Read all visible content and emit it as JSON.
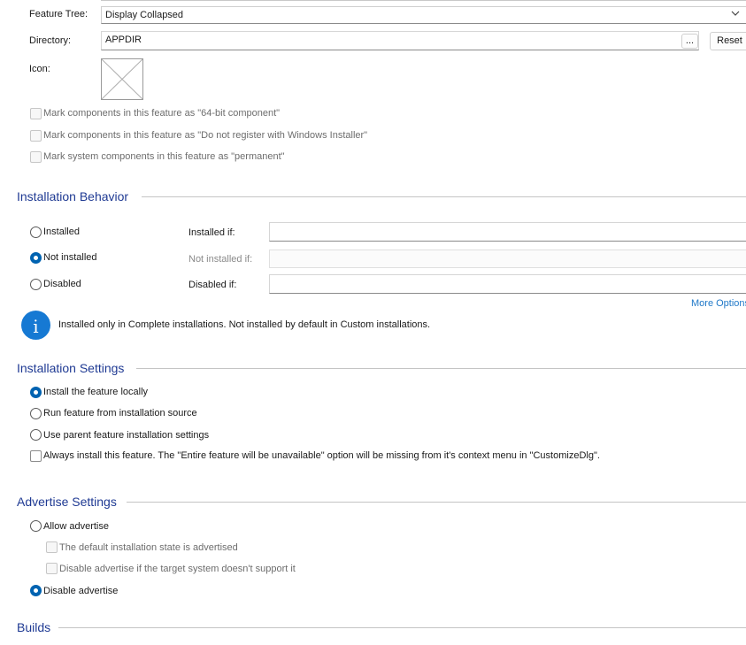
{
  "general": {
    "feature_tree_label": "Feature Tree:",
    "feature_tree_value": "Display Collapsed",
    "directory_label": "Directory:",
    "directory_value": "APPDIR",
    "browse_label": "...",
    "reset_label": "Reset",
    "icon_label": "Icon:",
    "options": [
      {
        "label": "Mark components in this feature as \"64-bit component\"",
        "checked": false,
        "enabled": false
      },
      {
        "label": "Mark components in this feature as \"Do not register with Windows Installer\"",
        "checked": false,
        "enabled": false
      },
      {
        "label": "Mark system components in this feature as \"permanent\"",
        "checked": false,
        "enabled": false
      }
    ]
  },
  "installation_behavior": {
    "title": "Installation Behavior",
    "radios": [
      {
        "label": "Installed",
        "selected": false
      },
      {
        "label": "Not installed",
        "selected": true
      },
      {
        "label": "Disabled",
        "selected": false
      }
    ],
    "conditions": [
      {
        "label": "Installed if:",
        "value": "",
        "enabled": true
      },
      {
        "label": "Not installed if:",
        "value": "",
        "enabled": false
      },
      {
        "label": "Disabled if:",
        "value": "",
        "enabled": true
      }
    ],
    "more_options": "More Options",
    "info_text": "Installed only in Complete installations. Not installed by default in Custom installations."
  },
  "installation_settings": {
    "title": "Installation Settings",
    "radios": [
      {
        "label": "Install the feature locally",
        "selected": true
      },
      {
        "label": "Run feature from installation source",
        "selected": false
      },
      {
        "label": "Use parent feature installation settings",
        "selected": false
      }
    ],
    "always_install": {
      "label": "Always install this feature. The \"Entire feature will be unavailable\" option will be missing from it's context menu in \"CustomizeDlg\".",
      "checked": false
    }
  },
  "advertise_settings": {
    "title": "Advertise Settings",
    "allow_label": "Allow advertise",
    "allow_selected": false,
    "sub_options": [
      {
        "label": "The default installation state is advertised",
        "checked": false,
        "enabled": false
      },
      {
        "label": "Disable advertise if the target system doesn't support it",
        "checked": false,
        "enabled": false
      }
    ],
    "disable_label": "Disable advertise",
    "disable_selected": true
  },
  "builds": {
    "title": "Builds"
  },
  "colors": {
    "section_title": "#1f3a93",
    "accent": "#0063b1",
    "link": "#1f78c8",
    "info_icon": "#1679d3"
  }
}
